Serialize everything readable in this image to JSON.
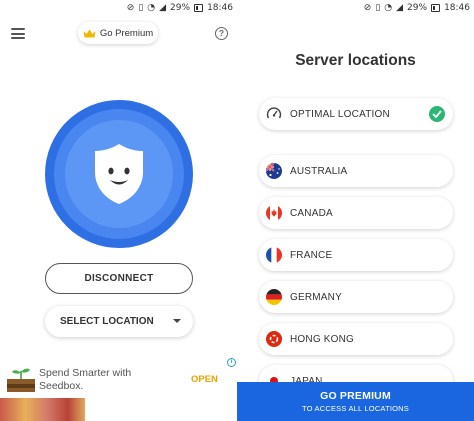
{
  "left": {
    "status": {
      "signal": "29%",
      "time": "18:46"
    },
    "go_premium_label": "Go Premium",
    "help_label": "?",
    "disconnect_label": "DISCONNECT",
    "select_location_label": "SELECT LOCATION",
    "ad": {
      "text": "Spend Smarter with Seedbox.",
      "open_label": "OPEN",
      "info_label": "i"
    }
  },
  "right": {
    "status": {
      "signal": "29%",
      "time": "18:46"
    },
    "title": "Server locations",
    "optimal": {
      "label": "OPTIMAL LOCATION",
      "selected": true
    },
    "locations": [
      {
        "label": "AUSTRALIA",
        "flag": "australia-flag"
      },
      {
        "label": "CANADA",
        "flag": "canada-flag"
      },
      {
        "label": "FRANCE",
        "flag": "france-flag"
      },
      {
        "label": "GERMANY",
        "flag": "germany-flag"
      },
      {
        "label": "HONG KONG",
        "flag": "hong-kong-flag"
      },
      {
        "label": "JAPAN",
        "flag": "japan-flag"
      }
    ],
    "premium_banner": {
      "title": "GO PREMIUM",
      "subtitle": "TO ACCESS ALL LOCATIONS"
    }
  },
  "colors": {
    "accent_blue": "#1a66e0",
    "shield_blue": "#2f6fe4",
    "check_green": "#2bb673",
    "ad_open": "#e8a500"
  }
}
